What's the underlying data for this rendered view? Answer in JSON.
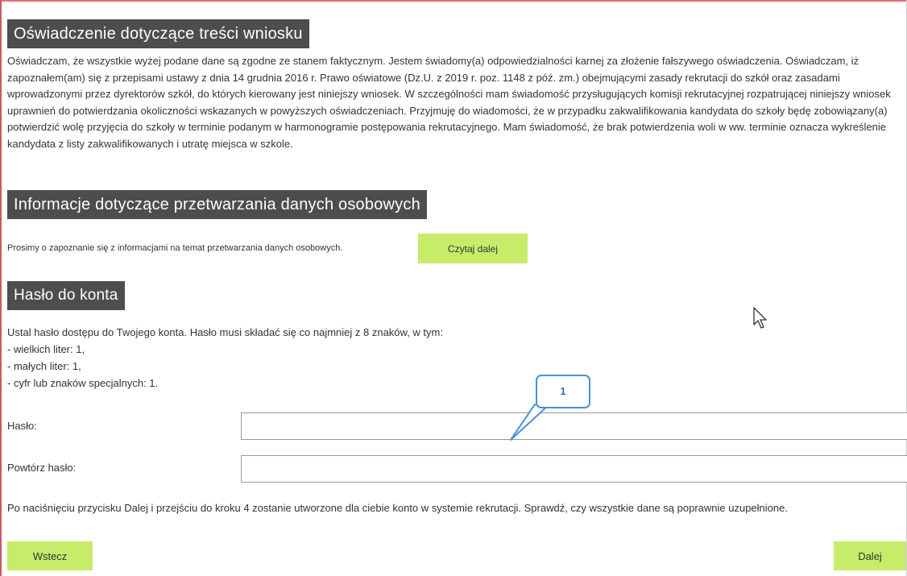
{
  "statement": {
    "title": "Oświadczenie dotyczące treści wniosku",
    "text": "Oświadczam, że wszystkie wyżej podane dane są zgodne ze stanem faktycznym. Jestem świadomy(a) odpowiedzialności karnej za złożenie fałszywego oświadczenia. Oświadczam, iż zapoznałem(am) się z przepisami ustawy z dnia 14 grudnia 2016 r. Prawo oświatowe (Dz.U. z 2019 r. poz. 1148 z póź. zm.) obejmującymi zasady rekrutacji do szkół oraz zasadami wprowadzonymi przez dyrektorów szkół, do których kierowany jest niniejszy wniosek. W szczególności mam świadomość przysługujących komisji rekrutacyjnej rozpatrującej niniejszy wniosek uprawnień do potwierdzania okoliczności wskazanych w powyższych oświadczeniach. Przyjmuję do wiadomości, że w przypadku zakwalifikowania kandydata do szkoły będę zobowiązany(a) potwierdzić wolę przyjęcia do szkoły w terminie podanym w harmonogramie postępowania rekrutacyjnego. Mam świadomość, że brak potwierdzenia woli w ww. terminie oznacza wykreślenie kandydata z listy zakwalifikowanych i utratę miejsca w szkole."
  },
  "privacy": {
    "title": "Informacje dotyczące przetwarzania danych osobowych",
    "text": "Prosimy o zapoznanie się z informacjami na temat przetwarzania danych osobowych.",
    "read_more_label": "Czytaj dalej"
  },
  "password": {
    "title": "Hasło do konta",
    "intro": "Ustal hasło dostępu do Twojego konta. Hasło musi składać się co najmniej z 8 znaków, w tym:",
    "requirements": [
      "- wielkich liter: 1,",
      "- małych liter: 1,",
      "- cyfr lub znaków specjalnych: 1."
    ],
    "password_label": "Hasło:",
    "password_value": "",
    "repeat_label": "Powtórz hasło:",
    "repeat_value": "",
    "info": "Po naciśnięciu przycisku Dalej i przejściu do kroku 4 zostanie utworzone dla ciebie konto w systemie rekrutacji. Sprawdź, czy wszystkie dane są poprawnie uzupełnione."
  },
  "annotation": {
    "callout_number": "1"
  },
  "nav": {
    "back_label": "Wstecz",
    "next_label": "Dalej"
  },
  "colors": {
    "header_bg": "#4d4d4d",
    "button_bg": "#c7ec6a",
    "callout_border": "#4a8fdc"
  },
  "icons": {
    "cursor": "mouse-pointer-icon"
  }
}
